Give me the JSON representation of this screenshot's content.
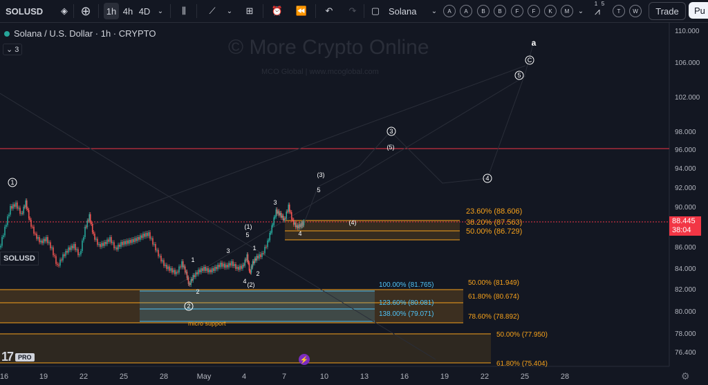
{
  "toolbar": {
    "symbol": "SOLUSD",
    "intervals": [
      "1h",
      "4h",
      "4D"
    ],
    "active_interval": "1h",
    "symbol_name": "Solana",
    "alerts": [
      "A",
      "A",
      "B",
      "B",
      "F",
      "F",
      "K",
      "M"
    ],
    "alerts_right": [
      "T",
      "W"
    ],
    "indicator_counts": [
      "1",
      "5"
    ],
    "trade_label": "Trade",
    "publish_label": "Pu"
  },
  "legend": {
    "title": "Solana / U.S. Dollar · 1h · CRYPTO",
    "collapsed_count": "3"
  },
  "watermark": {
    "main": "© More Crypto Online",
    "sub": "MCO Global  |  www.mcoglobal.com"
  },
  "price_axis": {
    "labels": [
      "110.000",
      "106.000",
      "102.000",
      "98.000",
      "96.000",
      "94.000",
      "92.000",
      "90.000",
      "86.000",
      "84.000",
      "82.000",
      "80.000",
      "78.000",
      "76.400"
    ],
    "current_price": "88.445",
    "countdown": "38:04"
  },
  "time_axis": {
    "labels": [
      "16",
      "19",
      "22",
      "25",
      "28",
      "May",
      "4",
      "7",
      "10",
      "13",
      "16",
      "19",
      "22",
      "25",
      "28"
    ]
  },
  "fib_labels": {
    "upper": [
      "23.60% (88.606)",
      "38.20% (87.563)",
      "50.00% (86.729)"
    ],
    "cyan": [
      "100.00% (81.765)",
      "123.60% (80.081)",
      "138.00% (79.071)"
    ],
    "orange_mid": [
      "50.00% (81.949)",
      "61.80% (80.674)",
      "78.60% (78.892)"
    ],
    "lower": [
      "50.00% (77.950)",
      "61.80% (75.404)"
    ]
  },
  "wave_labels": {
    "circled": [
      "1",
      "2",
      "3",
      "4",
      "5",
      "C"
    ],
    "a": "a",
    "paren": [
      "(1)",
      "(2)",
      "(3)",
      "(4)",
      "(5)"
    ],
    "minor": [
      "1",
      "2",
      "3",
      "4",
      "5"
    ]
  },
  "annotations": {
    "micro_support": "micro support"
  },
  "branding": {
    "logo": "17",
    "pro": "PRO"
  },
  "colors": {
    "background": "#131722",
    "up": "#26a69a",
    "down": "#ef5350",
    "fib_orange": "#f7a21b",
    "fib_cyan": "#4fc3f7",
    "resistance": "#f23645"
  }
}
